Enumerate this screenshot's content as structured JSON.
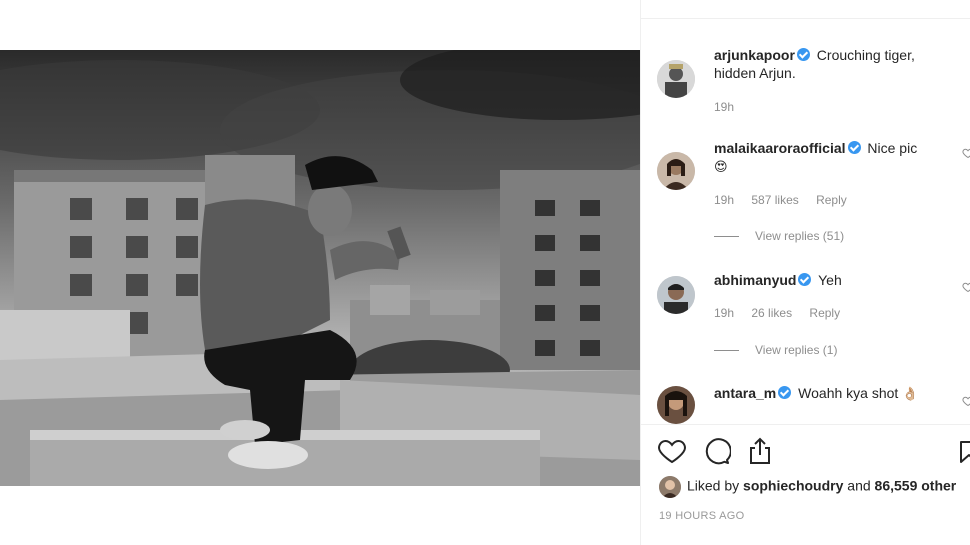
{
  "post": {
    "caption": {
      "username": "arjunkapoor",
      "text_line1": "Crouching tiger,",
      "text_line2": "hidden Arjun.",
      "time": "19h"
    },
    "comments": [
      {
        "username": "malaikaaroraofficial",
        "text": "Nice pic",
        "emoji": "😍",
        "time": "19h",
        "likes": "587 likes",
        "reply_label": "Reply",
        "view_replies": "View replies (51)"
      },
      {
        "username": "abhimanyud",
        "text": "Yeh",
        "time": "19h",
        "likes": "26 likes",
        "reply_label": "Reply",
        "view_replies": "View replies (1)"
      },
      {
        "username": "antara_m",
        "text": "Woahh kya shot",
        "emoji": "👌🏼"
      }
    ],
    "liked_by": {
      "prefix": "Liked by ",
      "user": "sophiechoudry",
      "middle": " and ",
      "count": "86,559 other"
    },
    "timestamp": "19 HOURS AGO"
  },
  "icons": {
    "like": "heart-icon",
    "comment": "comment-icon",
    "share": "share-icon",
    "save": "bookmark-icon",
    "verified": "verified-badge-icon"
  },
  "colors": {
    "verified": "#3897f0",
    "meta_text": "#8e8e8e",
    "text": "#262626"
  }
}
